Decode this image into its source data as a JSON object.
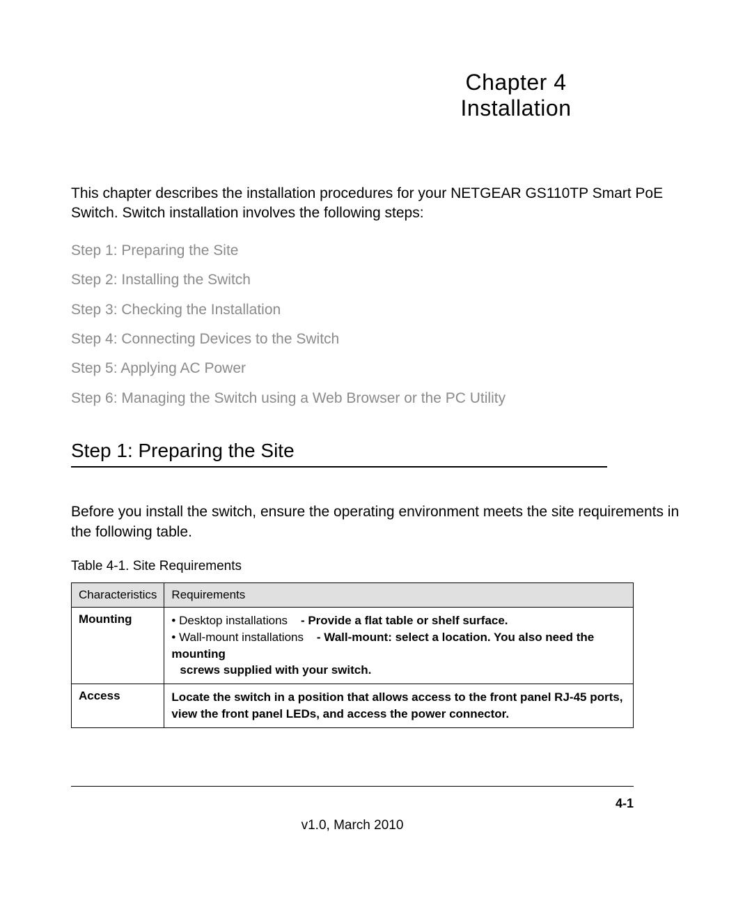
{
  "header": {
    "chapter_line": "Chapter  4",
    "chapter_title": "Installation"
  },
  "intro": "This chapter describes the installation procedures for your NETGEAR GS110TP Smart PoE Switch. Switch installation involves the following steps:",
  "steps": [
    "Step 1: Preparing the Site",
    "Step 2: Installing the Switch",
    "Step 3: Checking the Installation",
    "Step 4: Connecting Devices to the Switch",
    "Step 5: Applying AC Power",
    "Step 6: Managing the Switch using a Web Browser or the PC Utility"
  ],
  "section1": {
    "heading": "Step 1: Preparing the Site",
    "intro": "Before you install the switch, ensure the operating environment meets the site requirements in the following table.",
    "table_caption": "Table 4-1.  Site Requirements",
    "table": {
      "headers": [
        "Characteristics",
        "Requirements"
      ],
      "rows": [
        {
          "characteristic": "Mounting",
          "bullet1_label": "Desktop installations",
          "bullet1_desc": "- Provide a flat table or shelf surface.",
          "bullet2_label": "Wall-mount installations",
          "bullet2_desc": "- Wall-mount: select a location. You also need the mounting",
          "bullet2_cont": "screws supplied with your switch."
        },
        {
          "characteristic": "Access",
          "requirement": "Locate the switch in a position that allows access to the front panel RJ-45 ports, view the front panel LEDs, and access the power connector."
        }
      ]
    }
  },
  "footer": {
    "page_number": "4-1",
    "version": "v1.0, March 2010"
  }
}
